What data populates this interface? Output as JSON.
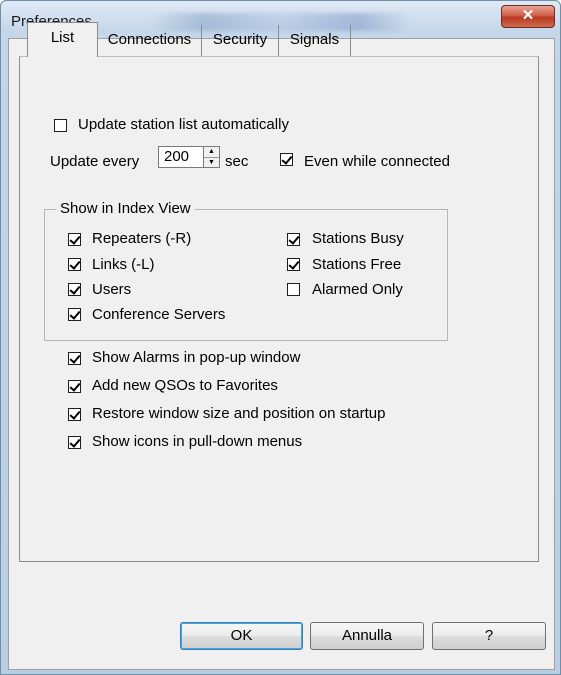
{
  "window": {
    "title": "Preferences",
    "close_glyph": "✕"
  },
  "tabs": [
    {
      "label": "List",
      "active": true
    },
    {
      "label": "Connections",
      "active": false
    },
    {
      "label": "Security",
      "active": false
    },
    {
      "label": "Signals",
      "active": false
    }
  ],
  "list_tab": {
    "update_automatically": {
      "label": "Update station list automatically",
      "checked": false
    },
    "update_every": {
      "label": "Update every",
      "value": "200",
      "unit": "sec"
    },
    "even_while_connected": {
      "label": "Even while connected",
      "checked": true
    },
    "index_view": {
      "title": "Show in Index View",
      "items": [
        {
          "label": "Repeaters (-R)",
          "checked": true
        },
        {
          "label": "Links (-L)",
          "checked": true
        },
        {
          "label": "Users",
          "checked": true
        },
        {
          "label": "Conference Servers",
          "checked": true
        },
        {
          "label": "Stations Busy",
          "checked": true
        },
        {
          "label": "Stations Free",
          "checked": true
        },
        {
          "label": "Alarmed Only",
          "checked": false
        }
      ]
    },
    "options": [
      {
        "label": "Show Alarms in pop-up window",
        "checked": true
      },
      {
        "label": "Add new QSOs to Favorites",
        "checked": true
      },
      {
        "label": "Restore window size and position on startup",
        "checked": true
      },
      {
        "label": "Show icons in pull-down menus",
        "checked": true
      }
    ]
  },
  "buttons": {
    "ok": "OK",
    "cancel": "Annulla",
    "help": "?"
  },
  "icons": {
    "spin_up": "up-arrow-icon",
    "spin_down": "down-arrow-icon",
    "close": "close-icon"
  }
}
